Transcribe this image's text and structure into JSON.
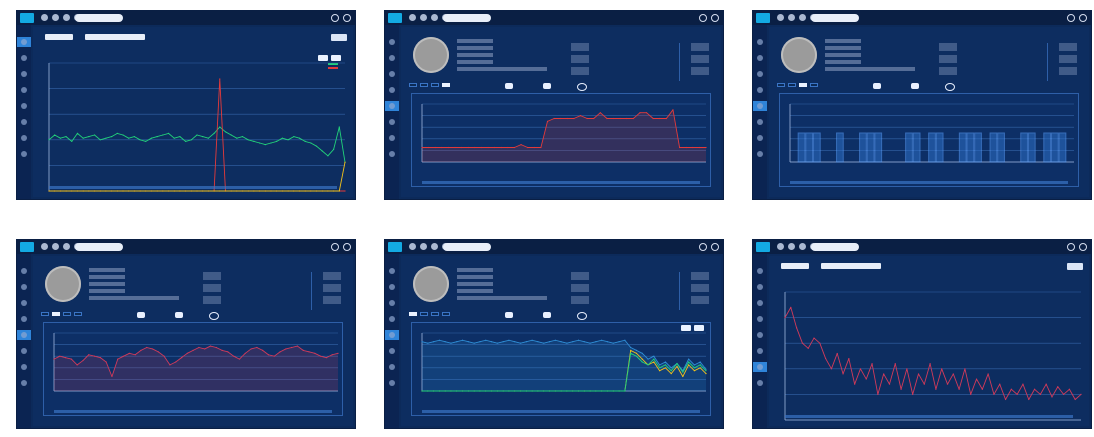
{
  "screens": [
    {
      "kind": "search",
      "search": {
        "label1": "",
        "label2": "",
        "button": ""
      },
      "chart": {
        "title": "",
        "ylabel": "",
        "legend": [
          "",
          ""
        ]
      },
      "chart_data": {
        "type": "line",
        "series": [
          {
            "color": "#22d27a",
            "values": [
              32,
              35,
              33,
              34,
              31,
              36,
              33,
              34,
              35,
              32,
              33,
              34,
              36,
              35,
              33,
              34,
              32,
              31,
              33,
              34,
              35,
              36,
              33,
              34,
              31,
              32,
              35,
              34,
              33,
              36,
              40,
              37,
              35,
              33,
              34,
              32,
              31,
              30,
              29,
              30,
              31,
              33,
              32,
              34,
              33,
              31,
              30,
              28,
              25,
              22,
              26,
              40,
              18
            ]
          },
          {
            "color": "#e33a3a",
            "values": [
              0,
              0,
              0,
              0,
              0,
              0,
              0,
              0,
              0,
              0,
              0,
              0,
              0,
              0,
              0,
              0,
              0,
              0,
              0,
              0,
              0,
              0,
              0,
              0,
              0,
              0,
              0,
              0,
              0,
              0,
              70,
              0,
              0,
              0,
              0,
              0,
              0,
              0,
              0,
              0,
              0,
              0,
              0,
              0,
              0,
              0,
              0,
              0,
              0,
              0,
              0,
              0,
              0
            ]
          },
          {
            "color": "#f2c21a",
            "values": [
              0,
              0,
              0,
              0,
              0,
              0,
              0,
              0,
              0,
              0,
              0,
              0,
              0,
              0,
              0,
              0,
              0,
              0,
              0,
              0,
              0,
              0,
              0,
              0,
              0,
              0,
              0,
              0,
              0,
              0,
              0,
              0,
              0,
              0,
              0,
              0,
              0,
              0,
              0,
              0,
              0,
              0,
              0,
              0,
              0,
              0,
              0,
              0,
              0,
              0,
              0,
              0,
              18
            ]
          }
        ],
        "ylim": [
          0,
          80
        ]
      }
    },
    {
      "kind": "profile",
      "tabs": [
        "",
        "",
        "",
        ""
      ],
      "chart": {
        "title": "",
        "ylabel": ""
      },
      "chart_data": {
        "type": "area",
        "series": [
          {
            "color": "#e33a3a",
            "values": [
              10,
              10,
              10,
              10,
              10,
              10,
              10,
              10,
              10,
              10,
              10,
              10,
              10,
              10,
              10,
              12,
              10,
              10,
              10,
              28,
              30,
              30,
              30,
              30,
              32,
              30,
              30,
              34,
              30,
              30,
              30,
              30,
              30,
              34,
              34,
              30,
              30,
              30,
              36,
              10,
              10,
              10,
              10,
              10
            ]
          }
        ],
        "ylim": [
          0,
          40
        ]
      }
    },
    {
      "kind": "profile",
      "tabs": [
        "",
        "",
        "",
        ""
      ],
      "chart": {
        "title": "",
        "ylabel": ""
      },
      "chart_data": {
        "type": "bar",
        "series": [
          {
            "color": "#2d6fc7",
            "values": [
              0,
              1,
              1,
              1,
              0,
              0,
              1,
              0,
              0,
              1,
              1,
              1,
              0,
              0,
              0,
              1,
              1,
              0,
              1,
              1,
              0,
              0,
              1,
              1,
              1,
              0,
              1,
              1,
              0,
              0,
              1,
              1,
              0,
              1,
              1,
              1,
              0
            ]
          }
        ],
        "ylim": [
          0,
          2
        ]
      }
    },
    {
      "kind": "profile",
      "tabs": [
        "",
        "",
        "",
        ""
      ],
      "chart": {
        "title": "",
        "ylabel": ""
      },
      "chart_data": {
        "type": "area",
        "series": [
          {
            "color": "#d13a5a",
            "values": [
              22,
              24,
              23,
              22,
              18,
              21,
              25,
              24,
              23,
              20,
              10,
              22,
              24,
              26,
              25,
              28,
              30,
              29,
              27,
              24,
              18,
              20,
              23,
              26,
              28,
              30,
              29,
              31,
              30,
              28,
              27,
              24,
              22,
              26,
              29,
              30,
              28,
              25,
              24,
              27,
              29,
              30,
              31,
              28,
              27,
              26,
              24,
              23,
              25,
              26
            ]
          }
        ],
        "ylim": [
          0,
          40
        ]
      }
    },
    {
      "kind": "profile",
      "tabs": [
        "",
        "",
        "",
        ""
      ],
      "chart": {
        "title": "",
        "ylabel": ""
      },
      "chart_data": {
        "type": "area",
        "series": [
          {
            "color": "#2f8ed6",
            "values": [
              34,
              33,
              34,
              35,
              34,
              33,
              34,
              35,
              34,
              33,
              34,
              35,
              34,
              33,
              34,
              35,
              34,
              33,
              34,
              35,
              34,
              33,
              34,
              35,
              34,
              33,
              34,
              35,
              34,
              33,
              34,
              35,
              34,
              33,
              34,
              35,
              30,
              28,
              26,
              22,
              24,
              18,
              20,
              16,
              19,
              14,
              22,
              18,
              20,
              15
            ]
          },
          {
            "color": "#f2c21a",
            "values": [
              0,
              0,
              0,
              0,
              0,
              0,
              0,
              0,
              0,
              0,
              0,
              0,
              0,
              0,
              0,
              0,
              0,
              0,
              0,
              0,
              0,
              0,
              0,
              0,
              0,
              0,
              0,
              0,
              0,
              0,
              0,
              0,
              0,
              0,
              0,
              0,
              28,
              26,
              22,
              18,
              20,
              14,
              16,
              12,
              17,
              10,
              18,
              14,
              16,
              12
            ]
          },
          {
            "color": "#22d27a",
            "values": [
              0,
              0,
              0,
              0,
              0,
              0,
              0,
              0,
              0,
              0,
              0,
              0,
              0,
              0,
              0,
              0,
              0,
              0,
              0,
              0,
              0,
              0,
              0,
              0,
              0,
              0,
              0,
              0,
              0,
              0,
              0,
              0,
              0,
              0,
              0,
              0,
              26,
              24,
              20,
              18,
              22,
              16,
              18,
              14,
              19,
              13,
              20,
              16,
              18,
              14
            ]
          }
        ],
        "ylim": [
          0,
          40
        ]
      }
    },
    {
      "kind": "search",
      "search": {
        "label1": "",
        "label2": "",
        "button": ""
      },
      "chart": {
        "title": "",
        "ylabel": ""
      },
      "chart_data": {
        "type": "line",
        "series": [
          {
            "color": "#d13a5a",
            "values": [
              40,
              44,
              36,
              30,
              28,
              32,
              30,
              24,
              20,
              26,
              18,
              24,
              14,
              20,
              16,
              22,
              10,
              18,
              14,
              22,
              12,
              20,
              10,
              18,
              14,
              22,
              12,
              20,
              14,
              18,
              12,
              20,
              10,
              16,
              12,
              18,
              10,
              14,
              8,
              12,
              10,
              14,
              8,
              12,
              10,
              14,
              9,
              13,
              10,
              12,
              8,
              10
            ]
          }
        ],
        "ylim": [
          0,
          50
        ]
      }
    }
  ]
}
